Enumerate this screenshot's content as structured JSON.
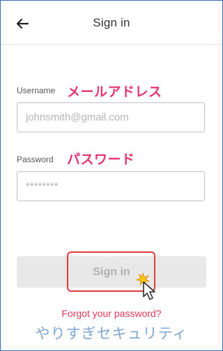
{
  "header": {
    "title": "Sign in",
    "back_icon": "arrow-left-icon"
  },
  "form": {
    "username": {
      "label": "Username",
      "annotation": "メールアドレス",
      "placeholder": "johnsmith@gmail.com",
      "value": ""
    },
    "password": {
      "label": "Password",
      "annotation": "パスワード",
      "placeholder": "********",
      "value": ""
    },
    "submit_label": "Sign in",
    "submit_state": "disabled"
  },
  "forgot_link": "Forgot your password?",
  "watermark": "やりすぎセキュリティ",
  "colors": {
    "annotation": "#e8336d",
    "link": "#e03a5a",
    "highlight_box": "#e03a3a",
    "watermark": "#7fa6d4",
    "button_bg": "#e8e8e8"
  }
}
